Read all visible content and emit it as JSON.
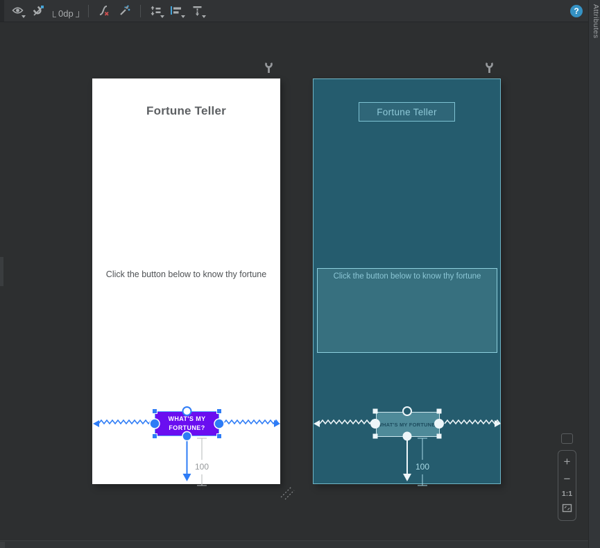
{
  "toolbar": {
    "default_margin": "0dp",
    "icons": [
      "view-options-icon",
      "autoconnect-off-icon",
      "default-margins-control",
      "clear-all-constraints-icon",
      "infer-constraints-icon",
      "pack-icon",
      "align-icon",
      "guidelines-icon"
    ],
    "help_label": "?"
  },
  "right_panel": {
    "tab_label": "Attributes"
  },
  "design_view": {
    "title": "Fortune Teller",
    "body": "Click the button below to know thy fortune",
    "button_label": "WHAT'S MY FORTUNE?",
    "bottom_margin": "100"
  },
  "blueprint_view": {
    "title": "Fortune Teller",
    "body": "Click the button below to know thy fortune",
    "button_label": "WHAT'S MY FORTUNE?",
    "bottom_margin": "100"
  },
  "zoom_controls": {
    "zoom_in": "+",
    "zoom_out": "−",
    "actual_size": "1:1"
  },
  "colors": {
    "accent_blue": "#2e7cf6",
    "button_purple": "#6a0ef0",
    "blueprint_bg": "#255c6e",
    "blueprint_line": "#8ed0de",
    "toolbar_bg": "#313335",
    "canvas_bg": "#2d2f30"
  }
}
